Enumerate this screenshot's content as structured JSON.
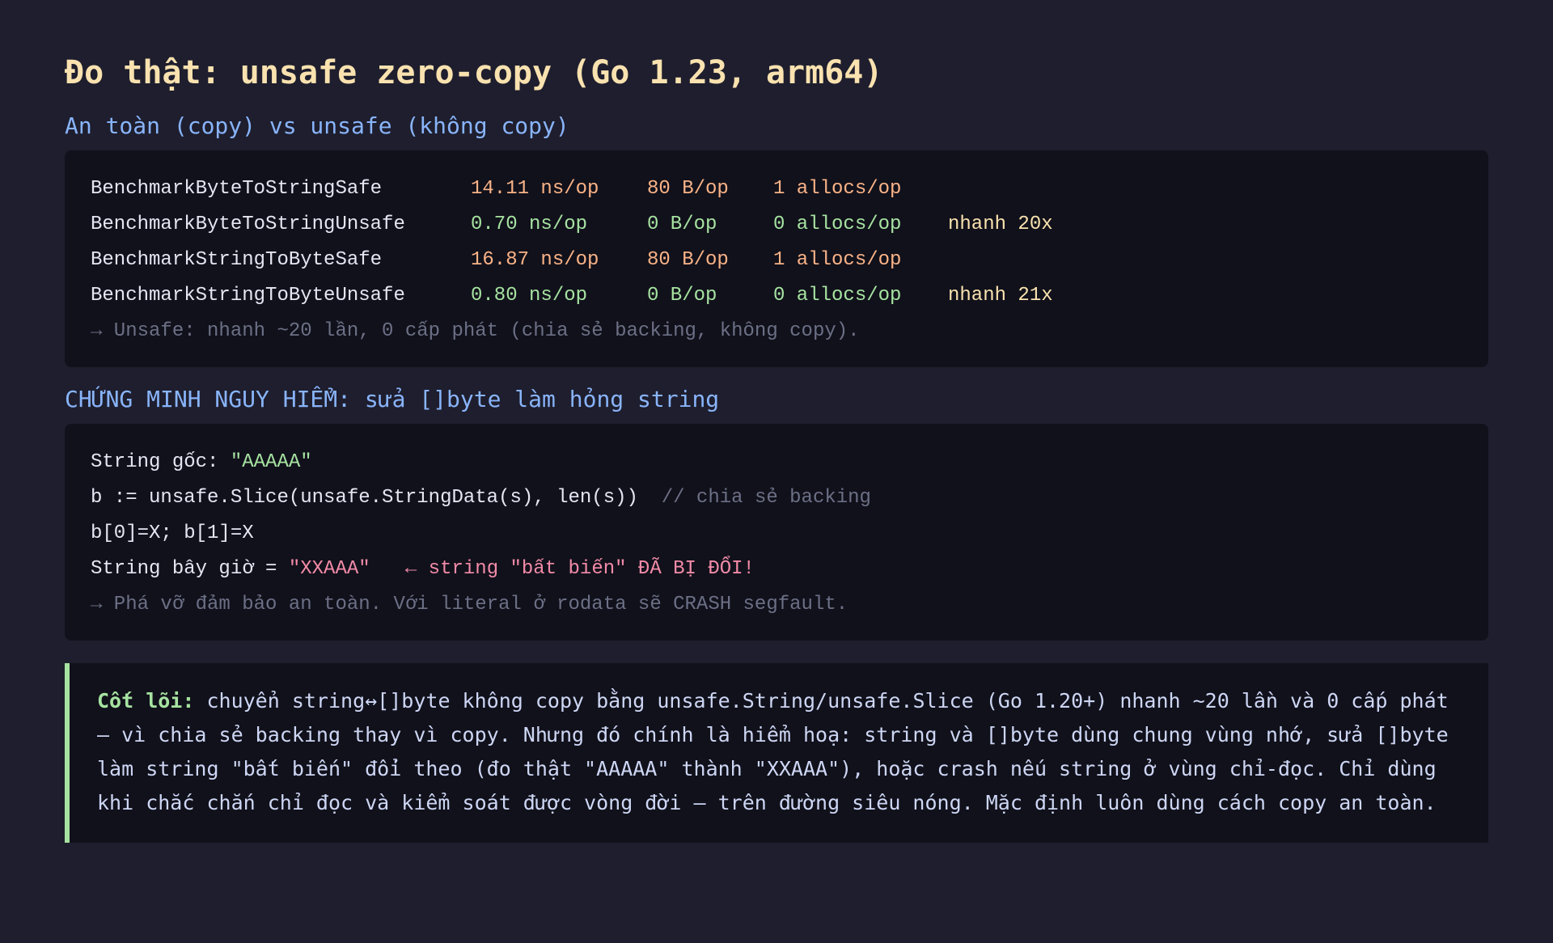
{
  "title": "Đo thật: unsafe zero-copy (Go 1.23, arm64)",
  "section1": {
    "heading": "An toàn (copy) vs unsafe (không copy)",
    "rows": [
      {
        "name": "BenchmarkByteToStringSafe",
        "ns": "14.11 ns/op",
        "bytes": "80 B/op",
        "allocs": "1 allocs/op",
        "speed": "",
        "status": "warn"
      },
      {
        "name": "BenchmarkByteToStringUnsafe",
        "ns": "0.70 ns/op",
        "bytes": "0 B/op",
        "allocs": "0 allocs/op",
        "speed": "nhanh 20x",
        "status": "good"
      },
      {
        "name": "BenchmarkStringToByteSafe",
        "ns": "16.87 ns/op",
        "bytes": "80 B/op",
        "allocs": "1 allocs/op",
        "speed": "",
        "status": "warn"
      },
      {
        "name": "BenchmarkStringToByteUnsafe",
        "ns": "0.80 ns/op",
        "bytes": "0 B/op",
        "allocs": "0 allocs/op",
        "speed": "nhanh 21x",
        "status": "good"
      }
    ],
    "note": "→ Unsafe: nhanh ~20 lần, 0 cấp phát (chia sẻ backing, không copy)."
  },
  "section2": {
    "heading": "CHỨNG MINH NGUY HIỂM: sửa []byte làm hỏng string",
    "line1_prefix": "String gốc: ",
    "line1_value": "\"AAAAA\"",
    "line2_code": "b := unsafe.Slice(unsafe.StringData(s), len(s))  ",
    "line2_comment": "// chia sẻ backing",
    "line3_code": "b[0]=X; b[1]=X",
    "line4_prefix": "String bây giờ = ",
    "line4_value": "\"XXAAA\"",
    "line4_warning": "   ← string \"bất biến\" ĐÃ BỊ ĐỔI!",
    "note": "→ Phá vỡ đảm bảo an toàn. Với literal ở rodata sẽ CRASH segfault."
  },
  "callout": {
    "label": "Cốt lõi:",
    "text": " chuyển string↔[]byte không copy bằng unsafe.String/unsafe.Slice (Go 1.20+) nhanh ~20 lần và 0 cấp phát — vì chia sẻ backing thay vì copy. Nhưng đó chính là hiểm hoạ: string và []byte dùng chung vùng nhớ, sửa []byte làm string \"bất biến\" đổi theo (đo thật \"AAAAA\" thành \"XXAAA\"), hoặc crash nếu string ở vùng chỉ-đọc. Chỉ dùng khi chắc chắn chỉ đọc và kiểm soát được vòng đời — trên đường siêu nóng. Mặc định luôn dùng cách copy an toàn."
  },
  "colors": {
    "background": "#1e1e2e",
    "panel": "#11111b",
    "title": "#f9e2af",
    "heading": "#89b4fa",
    "warn": "#fab387",
    "good": "#a6e3a1",
    "danger": "#f38ba8",
    "muted": "#6c7086"
  }
}
